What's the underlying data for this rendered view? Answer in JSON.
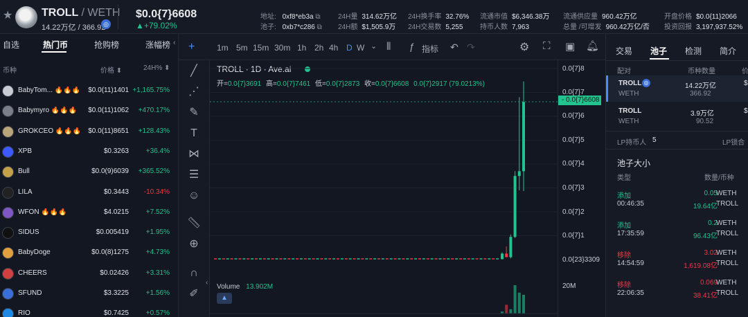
{
  "header": {
    "pair_base": "TROLL",
    "pair_quote": "/ WETH",
    "liquidity": "14.22万亿 / 366.92",
    "price": "$0.0{7}6608",
    "change": "▲+79.02%",
    "address_label": "地址:",
    "address": "0xf8*eb3a",
    "pool_label": "池子:",
    "pool": "0xb7*c286",
    "vol24_label": "24H量",
    "vol24": "314.62万亿",
    "amt24_label": "24H额",
    "amt24": "$1,505.9万",
    "turnover_label": "24H换手率",
    "turnover": "32.76%",
    "trades_label": "24H交易数",
    "trades": "5,255",
    "mcap_label": "流通市值",
    "mcap": "$6,346.38万",
    "holders_label": "持币人数",
    "holders": "7,963",
    "supply_label": "流通供应量",
    "supply": "960.42万亿",
    "total_label": "总量 /可增发",
    "total": "960.42万亿/否",
    "open_label": "开盘价格",
    "open": "$0.0{11}2066",
    "roi_label": "投资回报",
    "roi": "3,197,937.52%",
    "chain_badge": "◎"
  },
  "left": {
    "tabs": [
      "自选",
      "热门币",
      "抢购榜",
      "涨幅榜"
    ],
    "col_name": "币种",
    "col_price": "价格 ⬍",
    "col_change": "24H% ⬍",
    "rows": [
      {
        "name": "BabyTom... 🔥🔥🔥",
        "price": "$0.0(11)1401",
        "change": "+1,165.75%",
        "dir": "up",
        "color": "#c9ccd2"
      },
      {
        "name": "Babymyro 🔥🔥🔥",
        "price": "$0.0(11)1062",
        "change": "+470.17%",
        "dir": "up",
        "color": "#7a7f88"
      },
      {
        "name": "GROKCEO 🔥🔥🔥",
        "price": "$0.0(11)8651",
        "change": "+128.43%",
        "dir": "up",
        "color": "#b9a57a"
      },
      {
        "name": "XPB",
        "price": "$0.3263",
        "change": "+36.4%",
        "dir": "up",
        "color": "#3d5afe"
      },
      {
        "name": "Bull",
        "price": "$0.0(9)6039",
        "change": "+365.52%",
        "dir": "up",
        "color": "#c4a04a"
      },
      {
        "name": "LILA",
        "price": "$0.3443",
        "change": "-10.34%",
        "dir": "dn",
        "color": "#222"
      },
      {
        "name": "WFON 🔥🔥🔥",
        "price": "$4.0215",
        "change": "+7.52%",
        "dir": "up",
        "color": "#7e57c2"
      },
      {
        "name": "SIDUS",
        "price": "$0.005419",
        "change": "+1.95%",
        "dir": "up",
        "color": "#111"
      },
      {
        "name": "BabyDoge",
        "price": "$0.0(8)1275",
        "change": "+4.73%",
        "dir": "up",
        "color": "#e0a040"
      },
      {
        "name": "CHEERS",
        "price": "$0.02426",
        "change": "+3.31%",
        "dir": "up",
        "color": "#d04040"
      },
      {
        "name": "SFUND",
        "price": "$3.3225",
        "change": "+1.56%",
        "dir": "up",
        "color": "#3b6fd8"
      },
      {
        "name": "RIO",
        "price": "$0.7425",
        "change": "+0.57%",
        "dir": "up",
        "color": "#1e88e5"
      }
    ]
  },
  "toolbar": {
    "timeframes": [
      "1m",
      "5m",
      "15m",
      "30m",
      "1h",
      "2h",
      "4h",
      "D",
      "W"
    ],
    "active": "D",
    "indicators": "指标"
  },
  "chart_info": {
    "title": "TROLL · 1D · Ave.ai",
    "ohlc_open_k": "开=",
    "ohlc_open": "0.0{7}3691",
    "ohlc_high_k": "高=",
    "ohlc_high": "0.0{7}7461",
    "ohlc_low_k": "低=",
    "ohlc_low": "0.0{7}2873",
    "ohlc_close_k": "收=",
    "ohlc_close": "0.0{7}6608",
    "ohlc_diff": "0.0{7}2917 (79.0213%)",
    "volume_label": "Volume",
    "volume_value": "13.902M",
    "last_price_tag": "0.0{7}6608",
    "yticks": [
      "0.0{7}8",
      "0.0{7}7",
      "0.0{7}6",
      "0.0{7}5",
      "0.0{7}4",
      "0.0{7}3",
      "0.0{7}2",
      "0.0{7}1",
      "0.0{23}3309"
    ],
    "vol_tick": "20M"
  },
  "chart_data": {
    "type": "candlestick",
    "title": "TROLL · 1D · Ave.ai",
    "ylabels": [
      "0.0{7}8",
      "0.0{7}7",
      "0.0{7}6",
      "0.0{7}5",
      "0.0{7}4",
      "0.0{7}3",
      "0.0{7}2",
      "0.0{7}1",
      "0.0{23}3309"
    ],
    "flat_days": 70,
    "flat_level": 0,
    "candles": [
      {
        "open": 0.02,
        "high": 0.3,
        "low": 0.0,
        "close": 0.25
      },
      {
        "open": 0.25,
        "high": 0.55,
        "low": 0.1,
        "close": 0.1
      },
      {
        "open": 0.1,
        "high": 1.05,
        "low": 0.05,
        "close": 0.95
      },
      {
        "open": 0.95,
        "high": 3.7,
        "low": 0.9,
        "close": 3.5
      },
      {
        "open": 3.5,
        "high": 6.8,
        "low": 2.9,
        "close": 3.7
      },
      {
        "open": 3.7,
        "high": 7.46,
        "low": 2.87,
        "close": 6.6
      }
    ],
    "last_price": 6.608,
    "volumes_M": [
      1.5,
      6.5,
      3.2,
      21.0,
      15.5,
      13.9
    ],
    "volume_unit": "M"
  },
  "right": {
    "tabs": [
      "交易",
      "池子",
      "检测",
      "简介"
    ],
    "active": "池子",
    "col_pair": "配对",
    "col_amount": "币种数量",
    "col_price": "价",
    "pairs": [
      {
        "base": "TROLL",
        "quote": "WETH",
        "amt1": "14.22万亿",
        "amt2": "366.92",
        "p": "$"
      },
      {
        "base": "TROLL",
        "quote": "WETH",
        "amt1": "3.9万亿",
        "amt2": "90.52",
        "p": "$"
      }
    ],
    "lp_holders_label": "LP持币人",
    "lp_holders": "5",
    "lp_lock": "LP锁合",
    "pool_size_title": "池子大小",
    "col_type": "类型",
    "col_qty": "数量/币种",
    "trades": [
      {
        "type": "添加",
        "time": "00:46:35",
        "a1": "0.05",
        "s1": "WETH",
        "a2": "19.64亿",
        "s2": "TROLL",
        "dir": "up"
      },
      {
        "type": "添加",
        "time": "17:35:59",
        "a1": "0.2",
        "s1": "WETH",
        "a2": "96.43亿",
        "s2": "TROLL",
        "dir": "up"
      },
      {
        "type": "移除",
        "time": "14:54:59",
        "a1": "3.02",
        "s1": "WETH",
        "a2": "1,619.08亿",
        "s2": "TROLL",
        "dir": "dn"
      },
      {
        "type": "移除",
        "time": "22:06:35",
        "a1": "0.069",
        "s1": "WETH",
        "a2": "38.41亿",
        "s2": "TROLL",
        "dir": "dn"
      }
    ]
  },
  "colors": {
    "up": "#22c38e",
    "down": "#f23645",
    "accent": "#4b8df8",
    "bg": "#131722"
  }
}
